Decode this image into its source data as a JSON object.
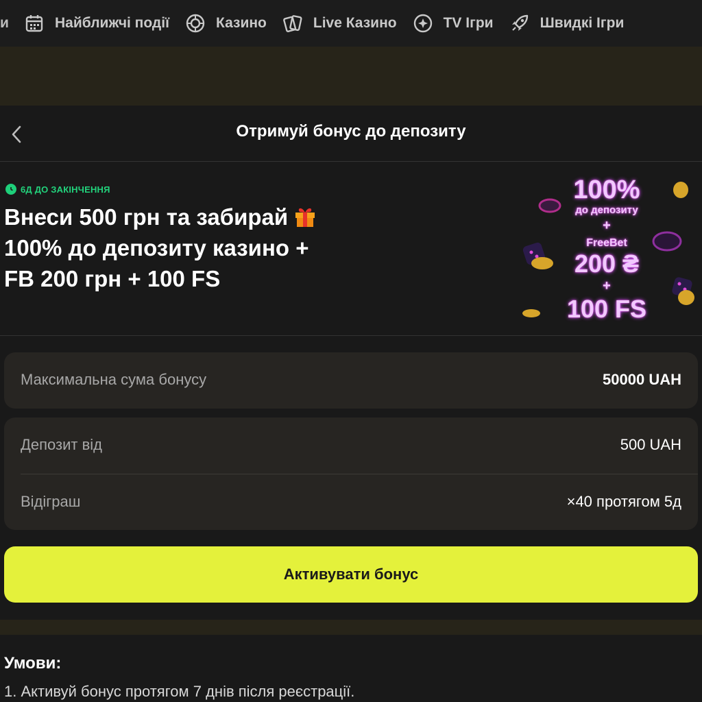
{
  "nav": {
    "cut_label": "и",
    "items": [
      {
        "label": "Найближчі події",
        "icon": "calendar-icon"
      },
      {
        "label": "Казино",
        "icon": "roulette-icon"
      },
      {
        "label": "Live Казино",
        "icon": "cards-icon"
      },
      {
        "label": "TV Ігри",
        "icon": "sparkle-icon"
      },
      {
        "label": "Швидкі Ігри",
        "icon": "rocket-icon"
      }
    ]
  },
  "header": {
    "title": "Отримуй бонус до депозиту",
    "back_icon": "chevron-left-icon"
  },
  "promo": {
    "timer_label": "6Д ДО ЗАКІНЧЕННЯ",
    "title_line1": "Внеси 500 грн та забирай",
    "title_line2": "100% до депозиту казино +",
    "title_line3": "FB 200 грн + 100 FS",
    "art": {
      "line1": "100%",
      "line2": "до депозиту",
      "plus": "+",
      "line3": "FreeBet",
      "line4": "200 ₴",
      "line5": "100 FS"
    }
  },
  "details": {
    "max_bonus_label": "Максимальна сума бонусу",
    "max_bonus_value": "50000 UAH",
    "deposit_label": "Депозит від",
    "deposit_value": "500 UAH",
    "wager_label": "Відіграш",
    "wager_value": "×40 протягом 5д"
  },
  "cta": {
    "label": "Активувати бонус"
  },
  "terms": {
    "title": "Умови:",
    "item1": "1. Активуй бонус протягом 7 днів після реєстрації."
  },
  "colors": {
    "background": "#191919",
    "accent": "#e4f13b",
    "timer_green": "#22d37c",
    "card": "#272522",
    "banner": "#272419"
  }
}
